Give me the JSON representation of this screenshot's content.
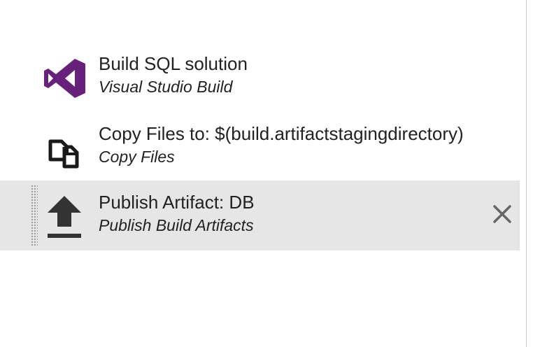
{
  "tasks": [
    {
      "title": "Build SQL solution",
      "subtitle": "Visual Studio Build",
      "icon": "visual-studio-icon"
    },
    {
      "title": "Copy Files to: $(build.artifactstagingdirectory)",
      "subtitle": "Copy Files",
      "icon": "copy-files-icon"
    },
    {
      "title": "Publish Artifact: DB",
      "subtitle": "Publish Build Artifacts",
      "icon": "upload-icon",
      "selected": true
    }
  ],
  "colors": {
    "vs_purple": "#68217a",
    "selected_bg": "#e6e6e6",
    "icon_dark": "#333333",
    "text": "#222222"
  }
}
